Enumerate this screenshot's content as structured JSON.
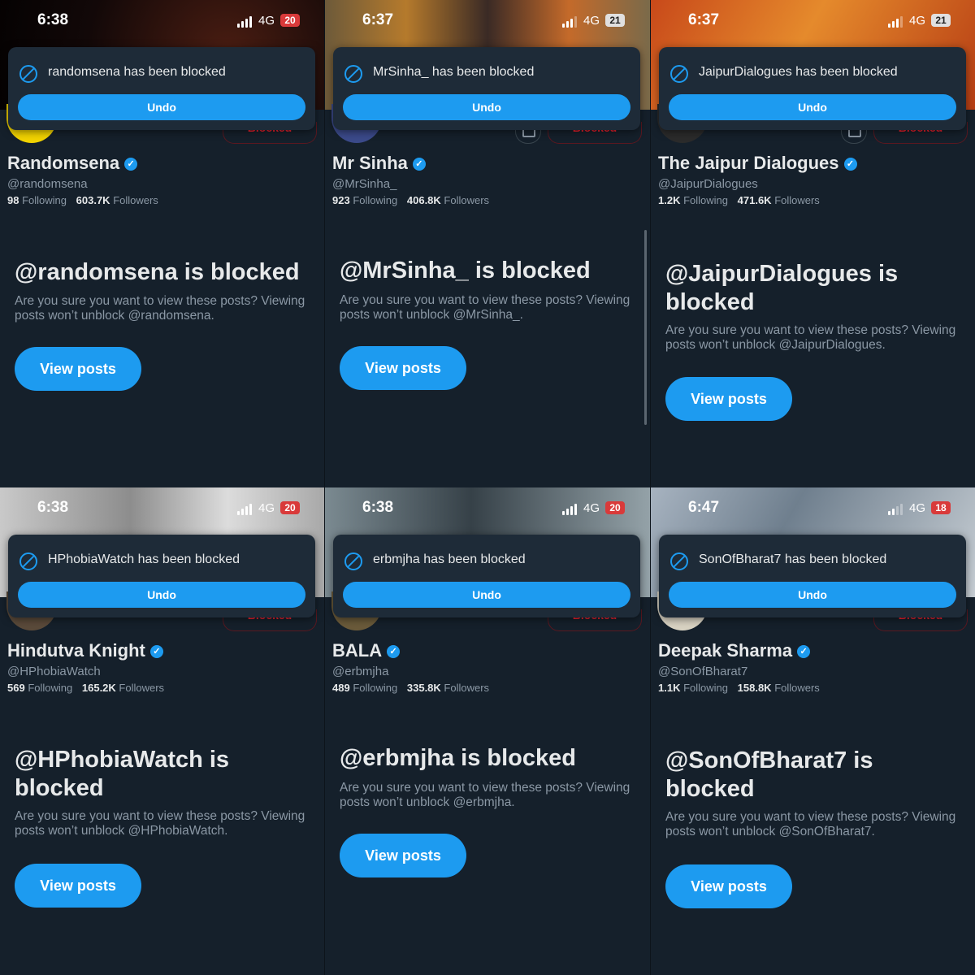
{
  "panels": [
    {
      "status": {
        "time": "6:38",
        "network": "4G",
        "battery": "20",
        "battery_low": true
      },
      "toast": {
        "text": "randomsena has been blocked",
        "undo_label": "Undo"
      },
      "blocked_label": "Blocked",
      "profile": {
        "name": "Randomsena",
        "handle": "@randomsena",
        "following_count": "98",
        "following_label": "Following",
        "followers_count": "603.7K",
        "followers_label": "Followers"
      },
      "blocked_heading": "@randomsena is blocked",
      "blocked_description": "Are you sure you want to view these posts? Viewing posts won’t unblock @randomsena.",
      "view_posts_label": "View posts"
    },
    {
      "status": {
        "time": "6:37",
        "network": "4G",
        "battery": "21",
        "battery_low": false
      },
      "toast": {
        "text": "MrSinha_ has been blocked",
        "undo_label": "Undo"
      },
      "blocked_label": "Blocked",
      "profile": {
        "name": "Mr Sinha",
        "handle": "@MrSinha_",
        "following_count": "923",
        "following_label": "Following",
        "followers_count": "406.8K",
        "followers_label": "Followers"
      },
      "blocked_heading": "@MrSinha_ is blocked",
      "blocked_description": "Are you sure you want to view these posts? Viewing posts won’t unblock @MrSinha_.",
      "view_posts_label": "View posts"
    },
    {
      "status": {
        "time": "6:37",
        "network": "4G",
        "battery": "21",
        "battery_low": false
      },
      "toast": {
        "text": "JaipurDialogues has been blocked",
        "undo_label": "Undo"
      },
      "blocked_label": "Blocked",
      "profile": {
        "name": "The Jaipur Dialogues",
        "handle": "@JaipurDialogues",
        "following_count": "1.2K",
        "following_label": "Following",
        "followers_count": "471.6K",
        "followers_label": "Followers"
      },
      "blocked_heading": "@JaipurDialogues is blocked",
      "blocked_description": "Are you sure you want to view these posts? Viewing posts won’t unblock @JaipurDialogues.",
      "view_posts_label": "View posts"
    },
    {
      "status": {
        "time": "6:38",
        "network": "4G",
        "battery": "20",
        "battery_low": true
      },
      "toast": {
        "text": "HPhobiaWatch has been blocked",
        "undo_label": "Undo"
      },
      "blocked_label": "Blocked",
      "profile": {
        "name": "Hindutva Knight",
        "handle": "@HPhobiaWatch",
        "following_count": "569",
        "following_label": "Following",
        "followers_count": "165.2K",
        "followers_label": "Followers"
      },
      "blocked_heading": "@HPhobiaWatch is blocked",
      "blocked_description": "Are you sure you want to view these posts? Viewing posts won’t unblock @HPhobiaWatch.",
      "view_posts_label": "View posts"
    },
    {
      "status": {
        "time": "6:38",
        "network": "4G",
        "battery": "20",
        "battery_low": true
      },
      "toast": {
        "text": "erbmjha has been blocked",
        "undo_label": "Undo"
      },
      "blocked_label": "Blocked",
      "profile": {
        "name": "BALA",
        "handle": "@erbmjha",
        "following_count": "489",
        "following_label": "Following",
        "followers_count": "335.8K",
        "followers_label": "Followers"
      },
      "blocked_heading": "@erbmjha is blocked",
      "blocked_description": "Are you sure you want to view these posts? Viewing posts won’t unblock @erbmjha.",
      "view_posts_label": "View posts"
    },
    {
      "status": {
        "time": "6:47",
        "network": "4G",
        "battery": "18",
        "battery_low": true
      },
      "toast": {
        "text": "SonOfBharat7 has been blocked",
        "undo_label": "Undo"
      },
      "blocked_label": "Blocked",
      "profile": {
        "name": "Deepak Sharma",
        "handle": "@SonOfBharat7",
        "following_count": "1.1K",
        "following_label": "Following",
        "followers_count": "158.8K",
        "followers_label": "Followers"
      },
      "blocked_heading": "@SonOfBharat7 is blocked",
      "blocked_description": "Are you sure you want to view these posts? Viewing posts won’t unblock @SonOfBharat7.",
      "view_posts_label": "View posts"
    }
  ],
  "colors": {
    "background": "#15202b",
    "accent": "#1d9bf0",
    "blocked_red": "#f4212e",
    "muted_text": "#8b98a5",
    "toast_bg": "#1e2b38"
  },
  "icons": {
    "toast": "block-icon",
    "verified": "verified-badge-icon",
    "signal": "signal-bars-icon",
    "camera": "camera-icon"
  }
}
